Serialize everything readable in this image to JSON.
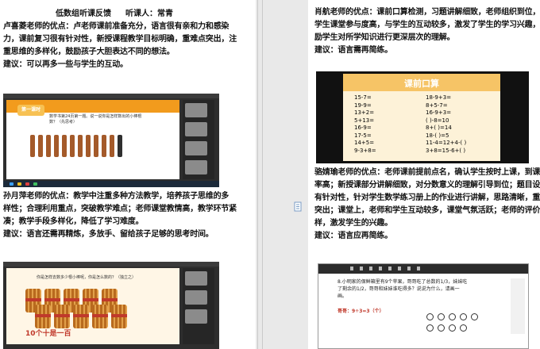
{
  "left_page": {
    "title": "低数组听课反馈",
    "listener": "听课人：常青",
    "p1": [
      "卢喜菱老师的优点：卢老师课前准备充分，语言很有亲和力和感染",
      "力，课前复习很有针对性，新授课程教学目标明确，重难点突出，注",
      "重思维的多样化，鼓励孩子大胆表达不同的想法。"
    ],
    "p1_suggest": "建议：可以再多一些与学生的互动。",
    "p2": [
      "孙月萍老师的优点：教学中注重多种方法教学，培养孩子思维的多",
      "样性；合理利用重点，突破教学难点；老师课堂教情高，教学环节紧",
      "凑；教学手段多样化，降低了学习难度。"
    ],
    "p2_suggest": "建议：语言还需再精炼，多放手、留给孩子足够的思考时间。",
    "shot1": {
      "tag": "第一课时",
      "text": "数学书第24页第一题。说一说你是怎样数出的小棒根数？（先思考）"
    },
    "shot2": {
      "question": "你是怎样去数多少根小棒呢，你是怎么数的？（独立之）",
      "caption": "10个十是一百"
    }
  },
  "right_page": {
    "p3": [
      "肖航老师的优点：课前口算检测，习题讲解细致，老师组织到位，",
      "学生课堂参与度高，与学生的互动较多，激发了学生的学习兴趣，鼓",
      "励学生对所学知识进行更深层次的理解。"
    ],
    "p3_suggest": "建议：语言需再简练。",
    "slide_title": "课前口算",
    "sums_left": [
      "15-7=",
      "19-9=",
      "13+2=",
      "5+13=",
      "16-9=",
      "17-5=",
      "14+5=",
      "9-3+8="
    ],
    "sums_right": [
      "18-9+3=",
      "8+5-7=",
      "16-9+3=",
      "(   )-8=10",
      "8+(   )=14",
      "18-(   )=5",
      "11-4=12+4-(   )",
      "3+8=15-6+(   )"
    ],
    "p4": [
      "骆婧瑜老师的优点：老师课前提前点名，确认学生按时上课，到课",
      "率高；新授课部分讲解细致，对分数意义的理解引导到位；题目设计",
      "有针对性，针对学生数学练习册上的作业进行讲解，思路清晰，重点",
      "突出；课堂上，老师和学生互动较多，课堂气氛活跃；老师的评价多",
      "样，激发学生的兴趣。"
    ],
    "p4_suggest": "建议：语言应再简练。",
    "problem": [
      "8.小明家的保鲜箱里有9个苹果，哥哥吃了总数的1/3，妹妹吃",
      "了剩余的1/2，哥哥和妹妹谁吃得多？说说为什么，请画一",
      "画。"
    ],
    "answer": "哥哥：9÷3=3（个）"
  },
  "colors": {
    "slide_orange": "#f29b1d",
    "caption_red": "#c0392b",
    "page_bg": "#e9e9e9"
  }
}
